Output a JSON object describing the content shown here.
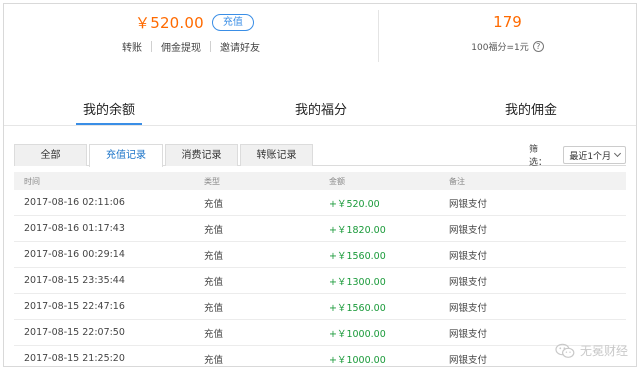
{
  "account": {
    "balance": "￥520.00",
    "recharge_label": "充值",
    "actions": [
      "转账",
      "佣金提现",
      "邀请好友"
    ],
    "points_value": "179",
    "points_note": "100福分=1元",
    "help_icon": "?"
  },
  "main_tabs": [
    {
      "label": "我的余额",
      "active": true
    },
    {
      "label": "我的福分",
      "active": false
    },
    {
      "label": "我的佣金",
      "active": false
    }
  ],
  "sub_tabs": [
    {
      "label": "全部",
      "active": false
    },
    {
      "label": "充值记录",
      "active": true
    },
    {
      "label": "消费记录",
      "active": false
    },
    {
      "label": "转账记录",
      "active": false
    }
  ],
  "filter": {
    "label": "筛选：",
    "selected": "最近1个月"
  },
  "table": {
    "headers": [
      "时间",
      "类型",
      "金额",
      "备注"
    ],
    "rows": [
      {
        "time": "2017-08-16 02:11:06",
        "type": "充值",
        "amount": "+￥520.00",
        "note": "网银支付"
      },
      {
        "time": "2017-08-16 01:17:43",
        "type": "充值",
        "amount": "+￥1820.00",
        "note": "网银支付"
      },
      {
        "time": "2017-08-16 00:29:14",
        "type": "充值",
        "amount": "+￥1560.00",
        "note": "网银支付"
      },
      {
        "time": "2017-08-15 23:35:44",
        "type": "充值",
        "amount": "+￥1300.00",
        "note": "网银支付"
      },
      {
        "time": "2017-08-15 22:47:16",
        "type": "充值",
        "amount": "+￥1560.00",
        "note": "网银支付"
      },
      {
        "time": "2017-08-15 22:07:50",
        "type": "充值",
        "amount": "+￥1000.00",
        "note": "网银支付"
      },
      {
        "time": "2017-08-15 21:25:20",
        "type": "充值",
        "amount": "+￥1000.00",
        "note": "网银支付"
      }
    ]
  },
  "watermark": {
    "text": "无冕财经",
    "icon": "wechat-icon"
  },
  "colors": {
    "accent": "#3a8ee6",
    "balance": "#ff6a00",
    "amount": "#1a9a3a"
  }
}
